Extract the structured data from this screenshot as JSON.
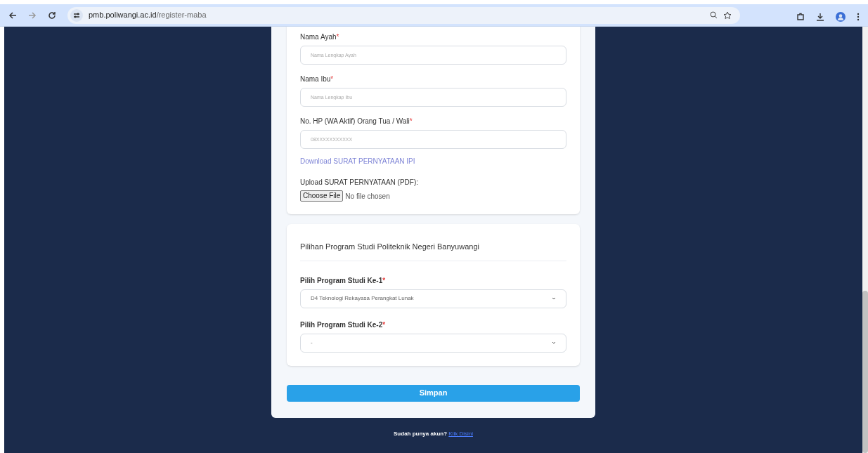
{
  "browser": {
    "url_host": "pmb.poliwangi.ac.id",
    "url_path": "/register-maba"
  },
  "section_1": {
    "fields": [
      {
        "kind": "text",
        "label": "Nama Ayah",
        "mark": "*",
        "placeholder": "Nama Lengkap Ayah"
      },
      {
        "kind": "text",
        "label": "Nama Ibu",
        "mark": "*",
        "placeholder": "Nama Lengkap Ibu"
      },
      {
        "kind": "text",
        "label": "No. HP (WA Aktif) Orang Tua / Wali",
        "mark": "*",
        "placeholder": "08XXXXXXXXXXX"
      },
      {
        "kind": "link",
        "text": "Download SURAT PERNYATAAN IPI"
      },
      {
        "kind": "file",
        "label": "Upload SURAT PERNYATAAN (PDF):",
        "button": "Choose File",
        "status": "No file chosen"
      }
    ]
  },
  "section_2": {
    "title": "Pilihan Program Studi Politeknik Negeri Banyuwangi",
    "fields": [
      {
        "kind": "select",
        "label": "Pilih Program Studi Ke-1",
        "mark": "*",
        "value": "D4 Teknologi Rekayasa Perangkat Lunak"
      },
      {
        "kind": "select",
        "label": "Pilih Program Studi Ke-2",
        "mark": "*",
        "value": "-"
      }
    ]
  },
  "submit": "Simpan",
  "footer": {
    "text": "Sudah punya akun?",
    "link": "Klik Disini"
  }
}
